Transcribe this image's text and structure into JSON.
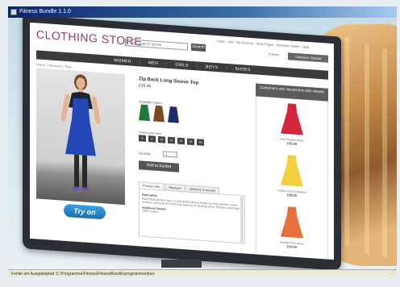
{
  "window": {
    "title": "Fitness Bundle 1.1.0",
    "status_text": "Fehler am Ausgabepfad: C:\\Programme\\Fitness\\FitnessBundle\\programmordner"
  },
  "store": {
    "logo": "CLOTHING STORE",
    "search": {
      "placeholder": "Enter search terms",
      "button_label": "Search"
    },
    "top_links": "Login · Join · My Account · Shop Pages · Recently Visited · Help",
    "cart_label": "0 Items",
    "checkout_label": "Checkout / Basket",
    "nav": [
      "WOMEN",
      "MEN",
      "GIRLS",
      "BOYS",
      "SHOES"
    ],
    "breadcrumb": "Home > Womens > Tops"
  },
  "product": {
    "title": "Zip Back Long Sleeve Top",
    "price": "£19.95",
    "colors_label": "Available Colors",
    "colors": [
      {
        "name": "green",
        "hex": "#1f7a3a"
      },
      {
        "name": "brown",
        "hex": "#7a4a1e"
      },
      {
        "name": "navy",
        "hex": "#1c2f6b"
      }
    ],
    "size_label": "Select your size",
    "sizes": [
      "6",
      "8",
      "10",
      "12",
      "14",
      "16",
      "18"
    ],
    "quantity_label": "Quantity",
    "quantity_value": "1",
    "basket_button": "Add to basket",
    "tabs": [
      "Product info",
      "Reviews",
      "Delivery & returns"
    ],
    "description_heading": "Description",
    "description_text": "Fully fitted zip back top in a soft stretch jersey. Flattering long sleeves, round neckline and easy fit. Perfect for layering or wearing alone. Machine washable.",
    "additional_heading": "Additional Details",
    "additional_text": "100% Cotton",
    "try_on_label": "Try on",
    "garment_color": "#2447b8"
  },
  "related": {
    "header": "Customers who viewed this also viewed",
    "items": [
      {
        "caption": "Red Pleated Dress",
        "price": "£35.00",
        "color": "#d4253a"
      },
      {
        "caption": "Yellow Floral Sundress",
        "price": "£28.00",
        "color": "#f3cf3e"
      },
      {
        "caption": "Orange Print Dress",
        "price": "£24.00",
        "color": "#e8703a"
      }
    ]
  }
}
